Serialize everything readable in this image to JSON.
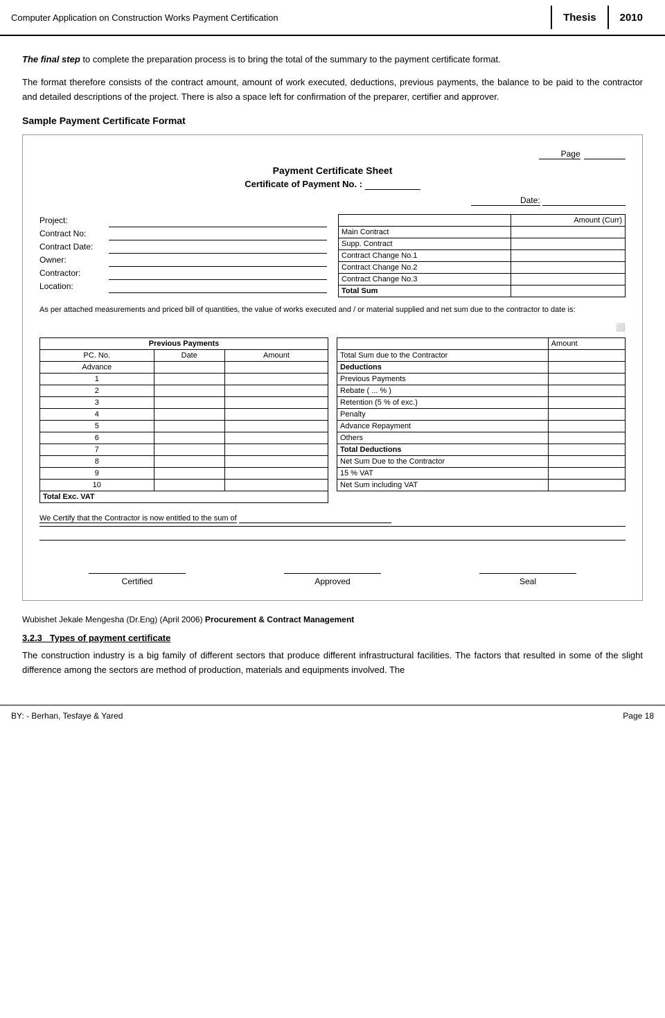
{
  "header": {
    "title": "Computer Application on Construction Works Payment Certification",
    "thesis_label": "Thesis",
    "year": "2010"
  },
  "intro": {
    "paragraph1_before": "The final step",
    "paragraph1_after": " to complete the preparation process is to bring the total of the summary to the payment certificate format.",
    "paragraph2": "The format therefore consists of the contract amount, amount of work executed, deductions, previous payments, the balance to be paid to the contractor and detailed descriptions of the project. There is also a space left for confirmation of the preparer, certifier and approver."
  },
  "sample_heading": "Sample Payment Certificate Format",
  "certificate": {
    "page_label": "Page",
    "title": "Payment Certificate Sheet",
    "subtitle_before": "Certificate of Payment No. :",
    "date_label": "Date:",
    "left_fields": [
      {
        "label": "Project:",
        "value": ""
      },
      {
        "label": "Contract No:",
        "value": ""
      },
      {
        "label": "Contract Date:",
        "value": ""
      },
      {
        "label": "Owner:",
        "value": ""
      },
      {
        "label": "Contractor:",
        "value": ""
      },
      {
        "label": "Location:",
        "value": ""
      }
    ],
    "right_table": {
      "header": "Amount (Curr)",
      "rows": [
        {
          "label": "Main Contract",
          "amount": ""
        },
        {
          "label": "Supp. Contract",
          "amount": ""
        },
        {
          "label": "Contract Change No.1",
          "amount": ""
        },
        {
          "label": "Contract Change No.2",
          "amount": ""
        },
        {
          "label": "Contract Change No.3",
          "amount": ""
        },
        {
          "label": "Total Sum",
          "amount": "",
          "bold": true
        }
      ]
    },
    "note": "As per attached measurements and priced bill of quantities, the value of works executed and / or material supplied and net sum due to the contractor to date is:",
    "prev_payments": {
      "section_header": "Previous Payments",
      "columns": [
        "PC. No.",
        "Date",
        "Amount"
      ],
      "rows": [
        {
          "num": "Advance",
          "date": "",
          "amount": ""
        },
        {
          "num": "1",
          "date": "",
          "amount": ""
        },
        {
          "num": "2",
          "date": "",
          "amount": ""
        },
        {
          "num": "3",
          "date": "",
          "amount": ""
        },
        {
          "num": "4",
          "date": "",
          "amount": ""
        },
        {
          "num": "5",
          "date": "",
          "amount": ""
        },
        {
          "num": "6",
          "date": "",
          "amount": ""
        },
        {
          "num": "7",
          "date": "",
          "amount": ""
        },
        {
          "num": "8",
          "date": "",
          "amount": ""
        },
        {
          "num": "9",
          "date": "",
          "amount": ""
        },
        {
          "num": "10",
          "date": "",
          "amount": ""
        }
      ],
      "total_row": "Total Exc. VAT"
    },
    "right_summary": {
      "amount_header": "Amount",
      "rows": [
        {
          "label": "Total Sum due to the Contractor",
          "amount": "",
          "bold": false
        },
        {
          "label": "Deductions",
          "amount": "",
          "bold": true
        },
        {
          "label": "Previous Payments",
          "amount": "",
          "bold": false
        },
        {
          "label": "Rebate ( ... % )",
          "amount": "",
          "bold": false
        },
        {
          "label": "Retention (5 % of exc.)",
          "amount": "",
          "bold": false
        },
        {
          "label": "Penalty",
          "amount": "",
          "bold": false
        },
        {
          "label": "Advance Repayment",
          "amount": "",
          "bold": false
        },
        {
          "label": "Others",
          "amount": "",
          "bold": false
        },
        {
          "label": "Total Deductions",
          "amount": "",
          "bold": true
        },
        {
          "label": "Net Sum Due to the Contractor",
          "amount": "",
          "bold": false
        },
        {
          "label": "15 % VAT",
          "amount": "",
          "bold": false
        },
        {
          "label": "Net Sum including VAT",
          "amount": "",
          "bold": false
        }
      ]
    },
    "certify_text": "We Certify that the Contractor is now entitled to the sum of",
    "signatures": [
      "Certified",
      "Approved",
      "Seal"
    ]
  },
  "footer_citation": "Wubishet Jekale Mengesha (Dr.Eng) (April 2006)",
  "footer_bold": "Procurement & Contract Management",
  "section_3": {
    "number": "3.2.3",
    "heading": "Types of payment certificate",
    "text": "The construction industry is a big family of different sectors that produce different infrastructural facilities. The factors that resulted in some of the slight difference among the sectors are method of production, materials and equipments involved. The"
  },
  "page_footer": {
    "left": "BY: - Berhan, Tesfaye & Yared",
    "right": "Page 18"
  }
}
